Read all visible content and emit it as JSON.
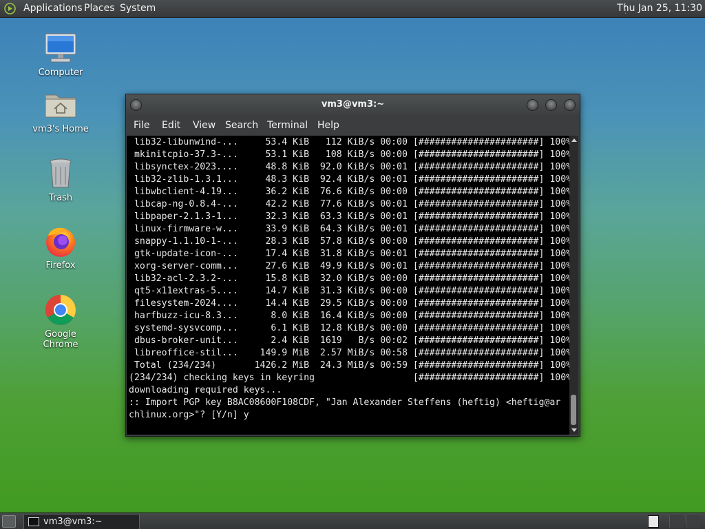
{
  "top_panel": {
    "menus": [
      "Applications",
      "Places",
      "System"
    ],
    "clock": "Thu Jan 25, 11:30"
  },
  "desktop_icons": [
    {
      "label": "Computer",
      "icon": "computer-icon"
    },
    {
      "label": "vm3's Home",
      "icon": "home-folder-icon"
    },
    {
      "label": "Trash",
      "icon": "trash-icon"
    },
    {
      "label": "Firefox",
      "icon": "firefox-icon"
    },
    {
      "label": "Google Chrome",
      "icon": "chrome-icon"
    }
  ],
  "terminal": {
    "title": "vm3@vm3:~",
    "menus": [
      "File",
      "Edit",
      "View",
      "Search",
      "Terminal",
      "Help"
    ],
    "lines": [
      " lib32-libunwind-...     53.4 KiB   112 KiB/s 00:00 [######################] 100%",
      " mkinitcpio-37.3-...     53.1 KiB   108 KiB/s 00:00 [######################] 100%",
      " libsynctex-2023....     48.8 KiB  92.0 KiB/s 00:01 [######################] 100%",
      " lib32-zlib-1.3.1...     48.3 KiB  92.4 KiB/s 00:01 [######################] 100%",
      " libwbclient-4.19...     36.2 KiB  76.6 KiB/s 00:00 [######################] 100%",
      " libcap-ng-0.8.4-...     42.2 KiB  77.6 KiB/s 00:01 [######################] 100%",
      " libpaper-2.1.3-1...     32.3 KiB  63.3 KiB/s 00:01 [######################] 100%",
      " linux-firmware-w...     33.9 KiB  64.3 KiB/s 00:01 [######################] 100%",
      " snappy-1.1.10-1-...     28.3 KiB  57.8 KiB/s 00:00 [######################] 100%",
      " gtk-update-icon-...     17.4 KiB  31.8 KiB/s 00:01 [######################] 100%",
      " xorg-server-comm...     27.6 KiB  49.9 KiB/s 00:01 [######################] 100%",
      " lib32-acl-2.3.2-...     15.8 KiB  32.0 KiB/s 00:00 [######################] 100%",
      " qt5-x11extras-5....     14.7 KiB  31.3 KiB/s 00:00 [######################] 100%",
      " filesystem-2024....     14.4 KiB  29.5 KiB/s 00:00 [######################] 100%",
      " harfbuzz-icu-8.3...      8.0 KiB  16.4 KiB/s 00:00 [######################] 100%",
      " systemd-sysvcomp...      6.1 KiB  12.8 KiB/s 00:00 [######################] 100%",
      " dbus-broker-unit...      2.4 KiB  1619   B/s 00:02 [######################] 100%",
      " libreoffice-stil...    149.9 MiB  2.57 MiB/s 00:58 [######################] 100%",
      " Total (234/234)       1426.2 MiB  24.3 MiB/s 00:59 [######################] 100%",
      "(234/234) checking keys in keyring                  [######################] 100%",
      "downloading required keys...",
      ":: Import PGP key B8AC08600F108CDF, \"Jan Alexander Steffens (heftig) <heftig@ar",
      "chlinux.org>\"? [Y/n] y"
    ]
  },
  "bottom_panel": {
    "task_label": "vm3@vm3:~"
  }
}
